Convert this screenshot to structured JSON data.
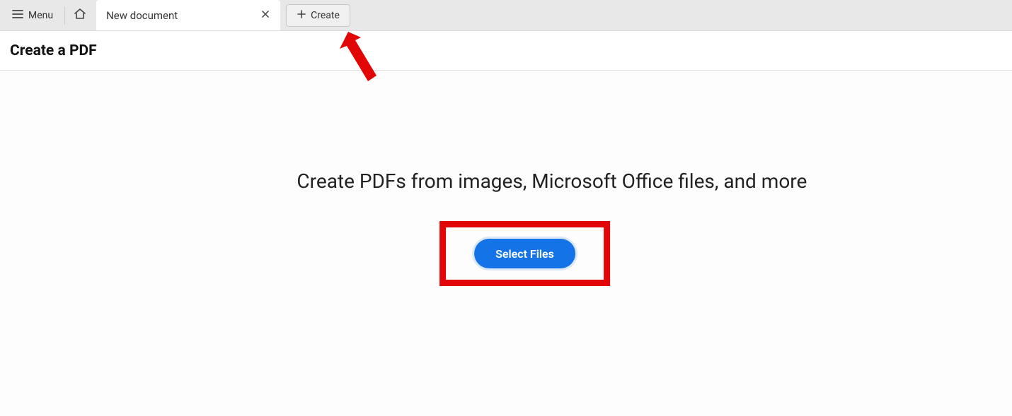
{
  "topbar": {
    "menu_label": "Menu",
    "create_label": "Create"
  },
  "tab": {
    "title": "New document"
  },
  "page": {
    "title": "Create a PDF"
  },
  "main": {
    "heading": "Create PDFs from images, Microsoft Office files, and more",
    "select_label": "Select Files"
  }
}
